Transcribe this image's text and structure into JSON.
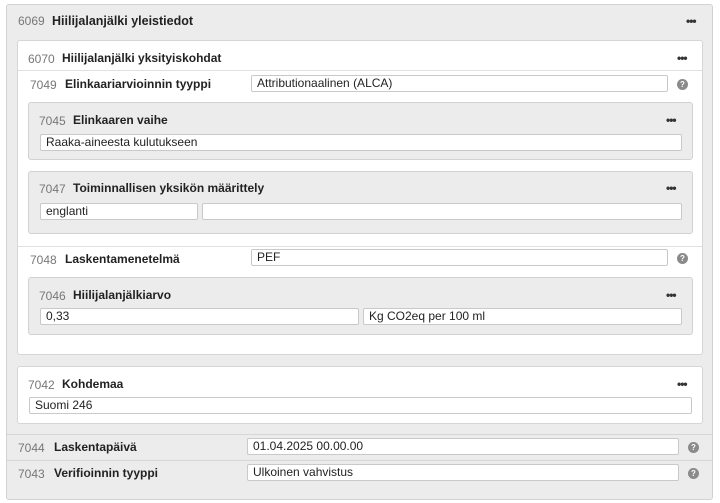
{
  "outer": {
    "code": "6069",
    "title": "Hiilijalanjälki yleistiedot",
    "menu": "•••"
  },
  "details": {
    "code": "6070",
    "title": "Hiilijalanjälki yksityiskohdat",
    "menu": "•••",
    "assessment_type": {
      "code": "7049",
      "label": "Elinkaariarvioinnin tyyppi",
      "value": "Attributionaalinen (ALCA)",
      "help": "?"
    },
    "lifecycle_stage": {
      "code": "7045",
      "label": "Elinkaaren vaihe",
      "menu": "•••",
      "value": "Raaka-aineesta kulutukseen"
    },
    "functional_unit": {
      "code": "7047",
      "label": "Toiminnallisen yksikön määrittely",
      "menu": "•••",
      "language": "englanti",
      "value": ""
    },
    "calc_method": {
      "code": "7048",
      "label": "Laskentamenetelmä",
      "value": "PEF",
      "help": "?"
    },
    "footprint_value": {
      "code": "7046",
      "label": "Hiilijalanjälkiarvo",
      "menu": "•••",
      "value": "0,33",
      "unit": "Kg CO2eq per 100 ml"
    }
  },
  "target_country": {
    "code": "7042",
    "label": "Kohdemaa",
    "menu": "•••",
    "value": "Suomi 246"
  },
  "calc_date": {
    "code": "7044",
    "label": "Laskentapäivä",
    "value": "01.04.2025 00.00.00",
    "help": "?"
  },
  "verification": {
    "code": "7043",
    "label": "Verifioinnin tyyppi",
    "value": "Ulkoinen vahvistus",
    "help": "?"
  }
}
